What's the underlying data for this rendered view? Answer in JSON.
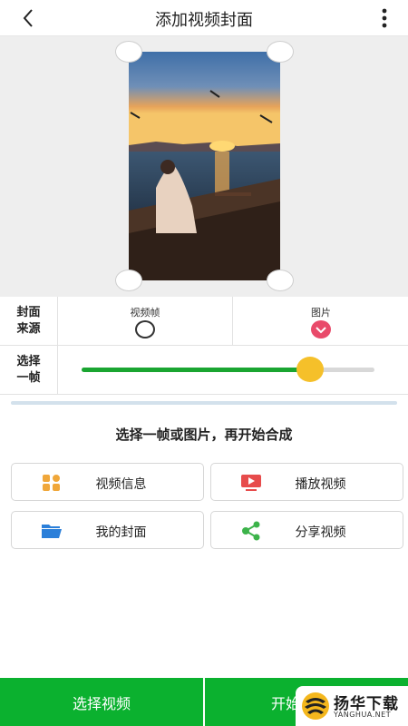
{
  "header": {
    "title": "添加视频封面",
    "back_icon": "chevron-left-icon",
    "more_icon": "more-vertical-icon"
  },
  "preview": {
    "image_description_icon": "sunset-photo"
  },
  "cover_source": {
    "label": "封面来源",
    "options": [
      {
        "label": "视频帧",
        "selected": false
      },
      {
        "label": "图片",
        "selected": true
      }
    ]
  },
  "frame_select": {
    "label": "选择一帧",
    "progress": 0.78
  },
  "instruction": "选择一帧或图片，再开始合成",
  "actions": [
    {
      "label": "视频信息",
      "icon": "grid-info-icon",
      "color": "#f0a73a"
    },
    {
      "label": "播放视频",
      "icon": "play-video-icon",
      "color": "#e74c4c"
    },
    {
      "label": "我的封面",
      "icon": "folder-icon",
      "color": "#2b7fd9"
    },
    {
      "label": "分享视频",
      "icon": "share-icon",
      "color": "#3cb34a"
    }
  ],
  "bottom": {
    "select_video": "选择视频",
    "start": "开始"
  },
  "watermark": {
    "brand": "扬华下载",
    "domain": "YANGHUA.NET"
  },
  "colors": {
    "accent_green": "#0bb12f",
    "slider_fill": "#1aa531",
    "slider_thumb": "#f5c02a",
    "radio_checked": "#e94a6a"
  }
}
